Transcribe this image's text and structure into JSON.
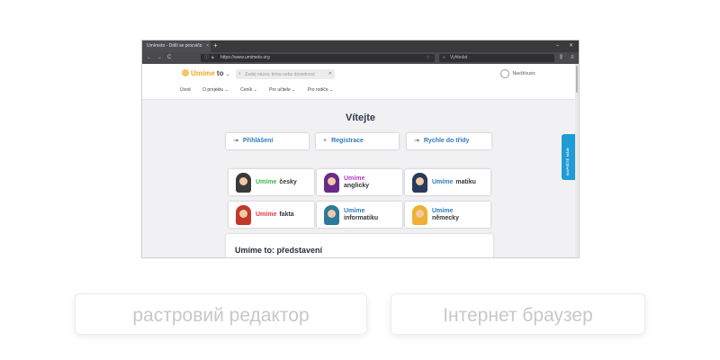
{
  "browser": {
    "tab_title": "Umímeto - Drillí se procvičo",
    "tab_close": "×",
    "new_tab": "+",
    "url": "https://www.umimeto.org",
    "search_placeholder": "Vyhledat",
    "nav_back": "←",
    "nav_forward": "→",
    "nav_reload": "C",
    "win_min": "–",
    "win_close": "✕"
  },
  "site": {
    "logo_brand": "Umíme",
    "logo_to": "to",
    "search_placeholder": "Zadej název, téma nebo dovednost",
    "login_label": "Navštívuvic",
    "menu": [
      "Úvod",
      "O projektu ⌄",
      "Ceník ⌄",
      "Pro učitele ⌄",
      "Pro rodiče ⌄"
    ],
    "welcome": "Vítejte",
    "buttons": [
      {
        "icon": "⇥",
        "label": "Přihlášení"
      },
      {
        "icon": "+",
        "label": "Registrace"
      },
      {
        "icon": "⇥",
        "label": "Rychle do třídy"
      }
    ],
    "cards": [
      {
        "brand": "Umíme",
        "subject": "česky",
        "color": "#3bb54a",
        "hair": "#3a3a3a"
      },
      {
        "brand": "Umíme",
        "subject": "anglicky",
        "color": "#b23dc6",
        "hair": "#6a2a8a"
      },
      {
        "brand": "Umíme",
        "subject": "matiku",
        "color": "#2e7bbd",
        "hair": "#2a3a5a"
      },
      {
        "brand": "Umíme",
        "subject": "fakta",
        "color": "#e53935",
        "hair": "#c0392b"
      },
      {
        "brand": "Umíme",
        "subject": "informatiku",
        "color": "#2e7bbd",
        "hair": "#2b7a9b"
      },
      {
        "brand": "Umíme",
        "subject": "německy",
        "color": "#2e7bbd",
        "hair": "#f0b030"
      }
    ],
    "intro_title": "Umíme to: představení",
    "feedback_label": "NAPIŠTE NÁM"
  },
  "answers": {
    "left": "растровий редактор",
    "right": "Інтернет браузер"
  },
  "colors": {
    "brand_yellow": "#f5a623",
    "link_blue": "#2e7bbd",
    "feedback_blue": "#1f9bd6"
  }
}
